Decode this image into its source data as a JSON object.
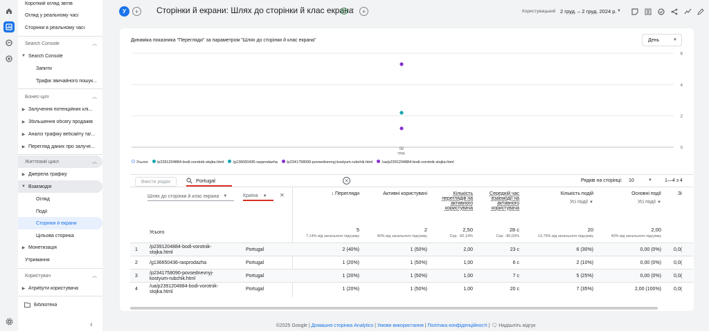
{
  "colors": {
    "accent": "#1a73e8",
    "series1": "#12a4af",
    "series2": "#8430ce",
    "total": "#7baaf7",
    "red": "#d93025"
  },
  "rail": [
    "home-icon",
    "reports-icon",
    "explore-icon",
    "advertising-icon",
    "settings-icon"
  ],
  "nav": {
    "items": [
      {
        "label": "Короткий огляд звітів"
      },
      {
        "label": "Огляд у реальному часі"
      },
      {
        "label": "Сторінки в реальному часі"
      },
      {
        "label": "Search Console"
      },
      {
        "label": "Search Console"
      },
      {
        "label": "Запити"
      },
      {
        "label": "Трафік звичайного пошук..."
      },
      {
        "label": "Бізнес-цілі"
      },
      {
        "label": "Залучення потенційних клі..."
      },
      {
        "label": "Збільшення обсягу продажів"
      },
      {
        "label": "Аналіз трафіку вебсайту та/..."
      },
      {
        "label": "Перегляд даних про залуче..."
      },
      {
        "label": "Життєвий цикл"
      },
      {
        "label": "Джерела трафіку"
      },
      {
        "label": "Взаємодія"
      },
      {
        "label": "Огляд"
      },
      {
        "label": "Події"
      },
      {
        "label": "Сторінки й екрани"
      },
      {
        "label": "Цільова сторінка"
      },
      {
        "label": "Монетизація"
      },
      {
        "label": "Утримання"
      },
      {
        "label": "Користувач"
      },
      {
        "label": "Атрибути користувача"
      },
      {
        "label": "Бібліотека"
      }
    ]
  },
  "topbar": {
    "avatar": "У",
    "title": "Сторінки й екрани: Шлях до сторінки й клас екрана",
    "date_label": "Користувацький",
    "date_range": "2 груд. – 2 груд. 2024 р."
  },
  "chart_data": {
    "type": "scatter",
    "title": "Динаміка показника \"Перегляди\" за параметром \"Шлях до сторінки й клас екрана\"",
    "x": [
      "02 груд."
    ],
    "ylim": [
      0,
      6
    ],
    "yticks": [
      "6",
      "4",
      "2",
      "0"
    ],
    "series": [
      {
        "name": "Усього",
        "values": [
          5
        ]
      },
      {
        "name": "/p2391204884-bodi-vorotnik-stojka.html",
        "values": [
          2
        ]
      },
      {
        "name": "/g136650436-rasprodazha",
        "values": [
          1
        ]
      },
      {
        "name": "/p2341758090-povsednevnyj-kostyum-rubchik.html",
        "values": [
          1
        ]
      },
      {
        "name": "/ua/p2391204884-bodi-vorotnik-stojka.html",
        "values": [
          1
        ]
      }
    ],
    "granularity": "День"
  },
  "table": {
    "search_placeholder": "Вмісти рядки",
    "search_value": "Portugal",
    "rows_per_page_label": "Рядків на сторінці:",
    "rows_per_page": "10",
    "pagination": "1—4 з 4",
    "dim1": "Шлях до сторінки й клас екрана",
    "dim2": "Країна",
    "total_label": "Усього",
    "headers": [
      {
        "label": "↓ Перегляди",
        "sub": ""
      },
      {
        "label": "Активні користувачі",
        "sub": ""
      },
      {
        "label": "Кількість переглядів на активного користувача",
        "sub": ""
      },
      {
        "label": "Середній час взаємодії на активного користувача",
        "sub": ""
      },
      {
        "label": "Кількість подій",
        "sub": "Усі події"
      },
      {
        "label": "Основні події",
        "sub": "Усі події"
      }
    ],
    "totals": [
      {
        "v": "5",
        "s": "7,14% від загального підсумку"
      },
      {
        "v": "2",
        "s": "40% від загального підсумку"
      },
      {
        "v": "2,50",
        "s": "Сер. -82,14%"
      },
      {
        "v": "28 с",
        "s": "Сер. -80,03%"
      },
      {
        "v": "20",
        "s": "13,79% від загального підсумку"
      },
      {
        "v": "2,00",
        "s": "40% від загального підсумку"
      }
    ],
    "rows": [
      {
        "n": "1",
        "path": "/p2391204884-bodi-vorotnik-stojka.html",
        "country": "Portugal",
        "c": [
          "2 (40%)",
          "1 (50%)",
          "2,00",
          "23 с",
          "6 (30%)",
          "0,00 (0%)"
        ]
      },
      {
        "n": "2",
        "path": "/g136650436-rasprodazha",
        "country": "Portugal",
        "c": [
          "1 (20%)",
          "1 (50%)",
          "1,00",
          "6 с",
          "2 (10%)",
          "0,00 (0%)"
        ]
      },
      {
        "n": "3",
        "path": "/p2341758090-povsednevnyj-kostyum-rubchik.html",
        "country": "Portugal",
        "c": [
          "1 (20%)",
          "1 (50%)",
          "1,00",
          "7 с",
          "5 (25%)",
          "0,00 (0%)"
        ]
      },
      {
        "n": "4",
        "path": "/ua/p2391204884-bodi-vorotnik-stojka.html",
        "country": "Portugal",
        "c": [
          "1 (20%)",
          "1 (50%)",
          "1,00",
          "20 с",
          "7 (35%)",
          "2,00 (100%)"
        ]
      }
    ]
  },
  "footer": {
    "copyright": "©2025 Google",
    "links": [
      "Домашня сторінка Analytics",
      "Умови використання",
      "Політика конфіденційності"
    ],
    "feedback": "Надішліть відгук"
  }
}
